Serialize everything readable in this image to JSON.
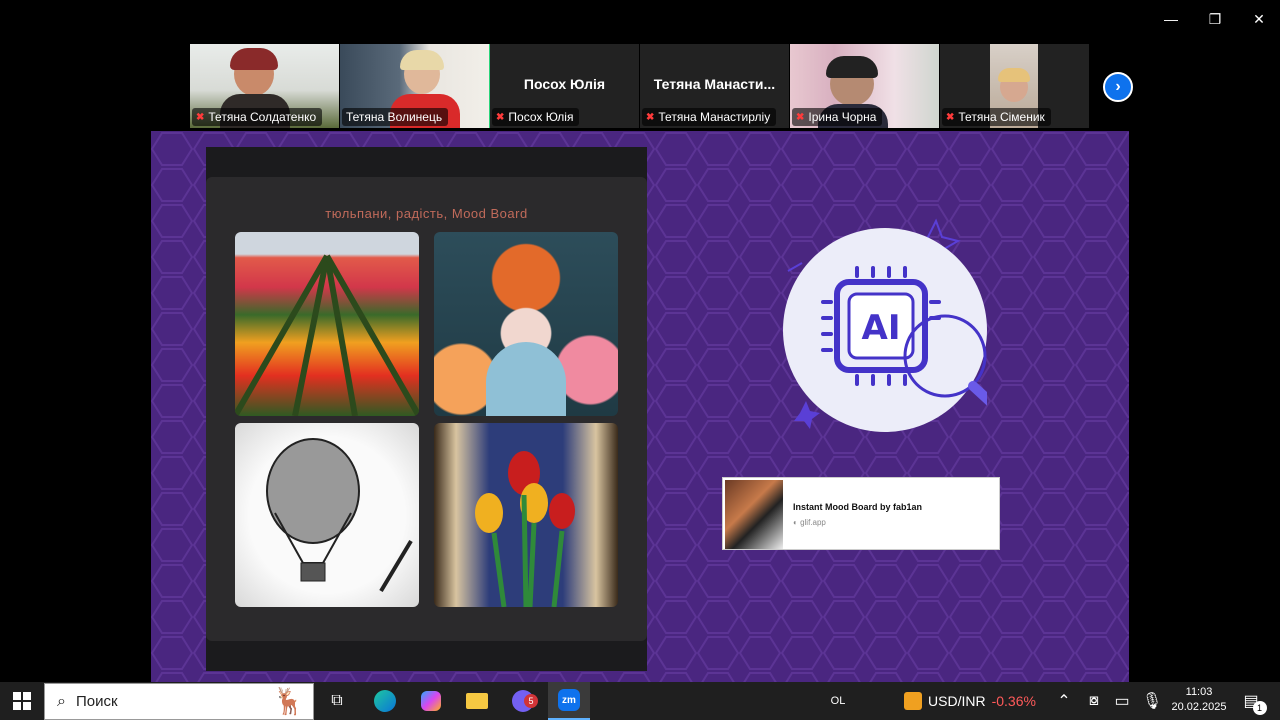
{
  "window": {
    "minimize": "—",
    "maximize": "❐",
    "close": "✕"
  },
  "participants": [
    {
      "name": "Тетяна Солдатенко",
      "video": true
    },
    {
      "name": "Тетяна Волинець",
      "video": true,
      "active": true
    },
    {
      "name": "Посох Юлія",
      "big_name": "Посох Юлія",
      "video": false
    },
    {
      "name": "Тетяна Манастирліу",
      "big_name": "Тетяна  Манасти...",
      "video": false
    },
    {
      "name": "Ірина Чорна",
      "video": true
    },
    {
      "name": "Тетяна Сіменик",
      "video": true
    }
  ],
  "shared": {
    "board_title": "тюльпани, радість, Mood Board",
    "ai_label": "AI",
    "gif_title": "Instant Mood Board by fab1an",
    "gif_source": "glif.app"
  },
  "taskbar": {
    "search_placeholder": "Поиск",
    "lang": "OL",
    "ticker": "USD/INR",
    "ticker_change": "-0.36%",
    "time": "11:03",
    "date": "20.02.2025",
    "viber_badge": "5",
    "notif_badge": "1"
  },
  "colors": {
    "accent": "#0e72ed",
    "share_bg": "#4a2680",
    "active_border": "#2bd47a",
    "negative": "#ff5a5a"
  }
}
